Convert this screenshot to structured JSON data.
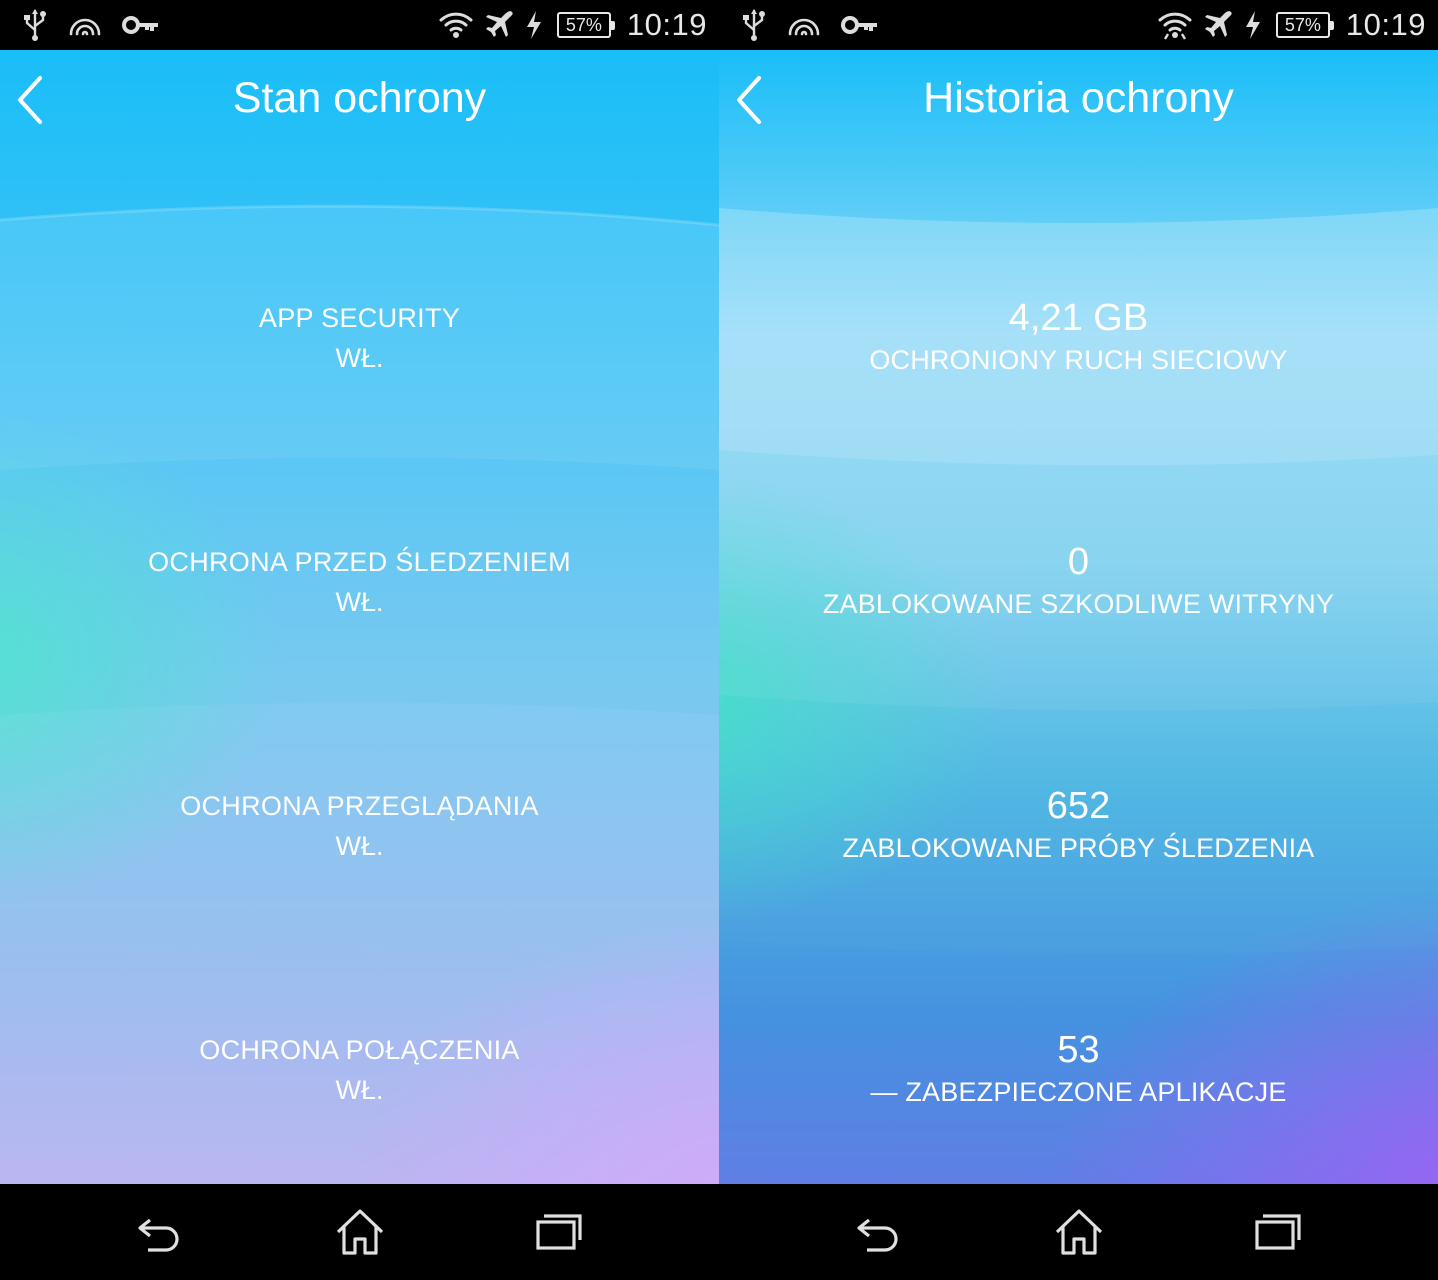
{
  "status_bar": {
    "battery": "57%",
    "time": "10:19",
    "left_icons": [
      "usb-icon",
      "nfc-icon",
      "vpn-key-icon"
    ],
    "right_icons": [
      "wifi-icon",
      "airplane-icon",
      "charging-icon",
      "battery-icon"
    ]
  },
  "left_screen": {
    "title": "Stan ochrony",
    "sections": [
      {
        "label": "APP SECURITY",
        "value": "WŁ."
      },
      {
        "label": "OCHRONA PRZED ŚLEDZENIEM",
        "value": "WŁ."
      },
      {
        "label": "OCHRONA PRZEGLĄDANIA",
        "value": "WŁ."
      },
      {
        "label": "OCHRONA POŁĄCZENIA",
        "value": "WŁ."
      }
    ]
  },
  "right_screen": {
    "title": "Historia ochrony",
    "stats": [
      {
        "value": "4,21 GB",
        "caption": "OCHRONIONY RUCH SIECIOWY"
      },
      {
        "value": "0",
        "caption": "ZABLOKOWANE SZKODLIWE WITRYNY"
      },
      {
        "value": "652",
        "caption": "ZABLOKOWANE PRÓBY ŚLEDZENIA"
      },
      {
        "value": "53",
        "caption": "— ZABEZPIECZONE APLIKACJE"
      }
    ]
  },
  "nav_bar": {
    "buttons": [
      "back-icon",
      "home-icon",
      "recent-apps-icon"
    ]
  },
  "colors": {
    "top": "#19bef8",
    "teal_accent": "#46e1cd",
    "violet_accent_left": "#cda0fa",
    "violet_accent_right": "#9b5ff5"
  }
}
